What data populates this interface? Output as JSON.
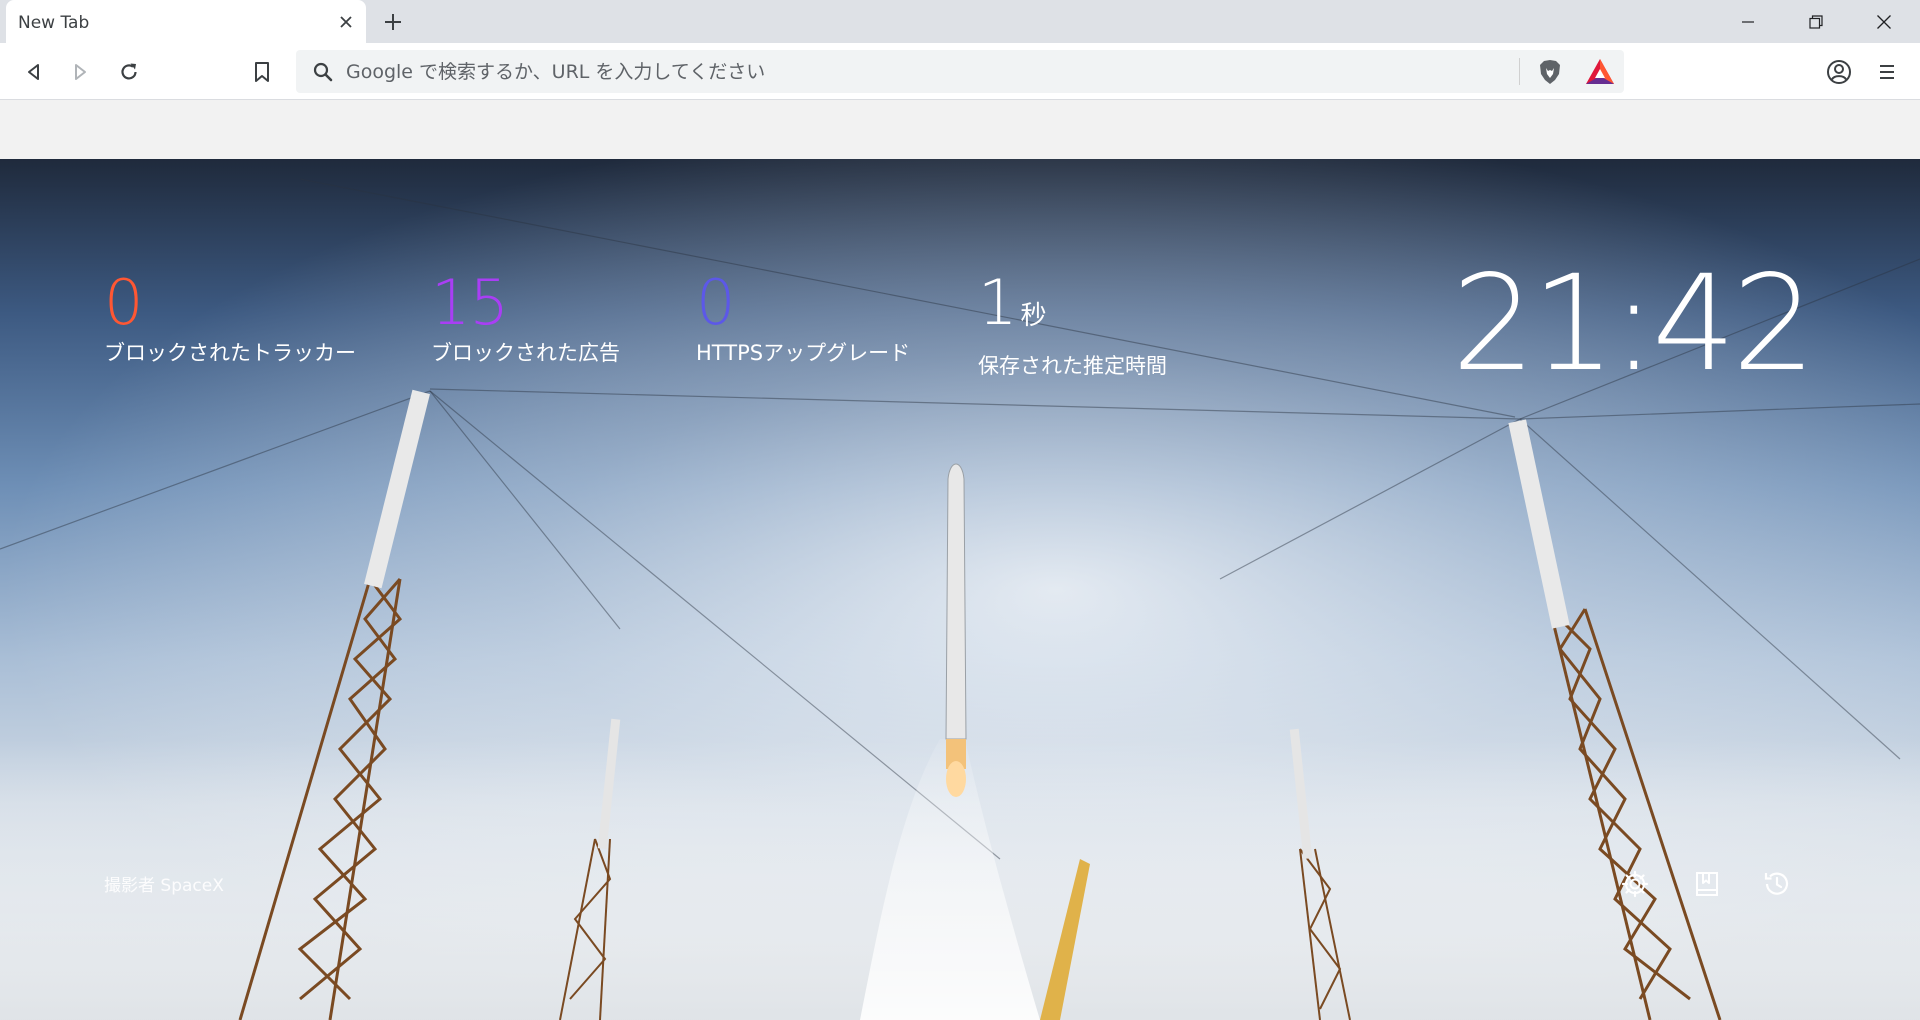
{
  "tab": {
    "title": "New Tab"
  },
  "omnibox": {
    "placeholder": "Google で検索するか、URL を入力してください",
    "value": ""
  },
  "stats": {
    "trackers": {
      "value": "0",
      "label": "ブロックされたトラッカー",
      "color": "#ff5733"
    },
    "ads": {
      "value": "15",
      "label": "ブロックされた広告",
      "color": "#a93ef5"
    },
    "https": {
      "value": "0",
      "label": "HTTPSアップグレード",
      "color": "#5c58e8"
    },
    "time": {
      "value": "1",
      "unit": "秒",
      "label": "保存された推定時間",
      "color": "#ffffff"
    }
  },
  "clock": {
    "time": "21:42"
  },
  "background": {
    "credit": "撮影者 SpaceX"
  },
  "colors": {
    "brave_orange": "#fb542b",
    "bat_red": "#e0183b",
    "bat_purple": "#662d91"
  },
  "icons": {
    "back": "back-icon",
    "forward": "forward-icon",
    "reload": "reload-icon",
    "bookmark": "bookmark-icon",
    "search": "search-icon",
    "brave_shields": "brave-shields-icon",
    "rewards": "bat-rewards-icon",
    "profile": "profile-icon",
    "menu": "menu-icon",
    "settings": "gear-icon",
    "bookmarks_ntp": "bookmarks-icon",
    "history": "history-icon"
  }
}
